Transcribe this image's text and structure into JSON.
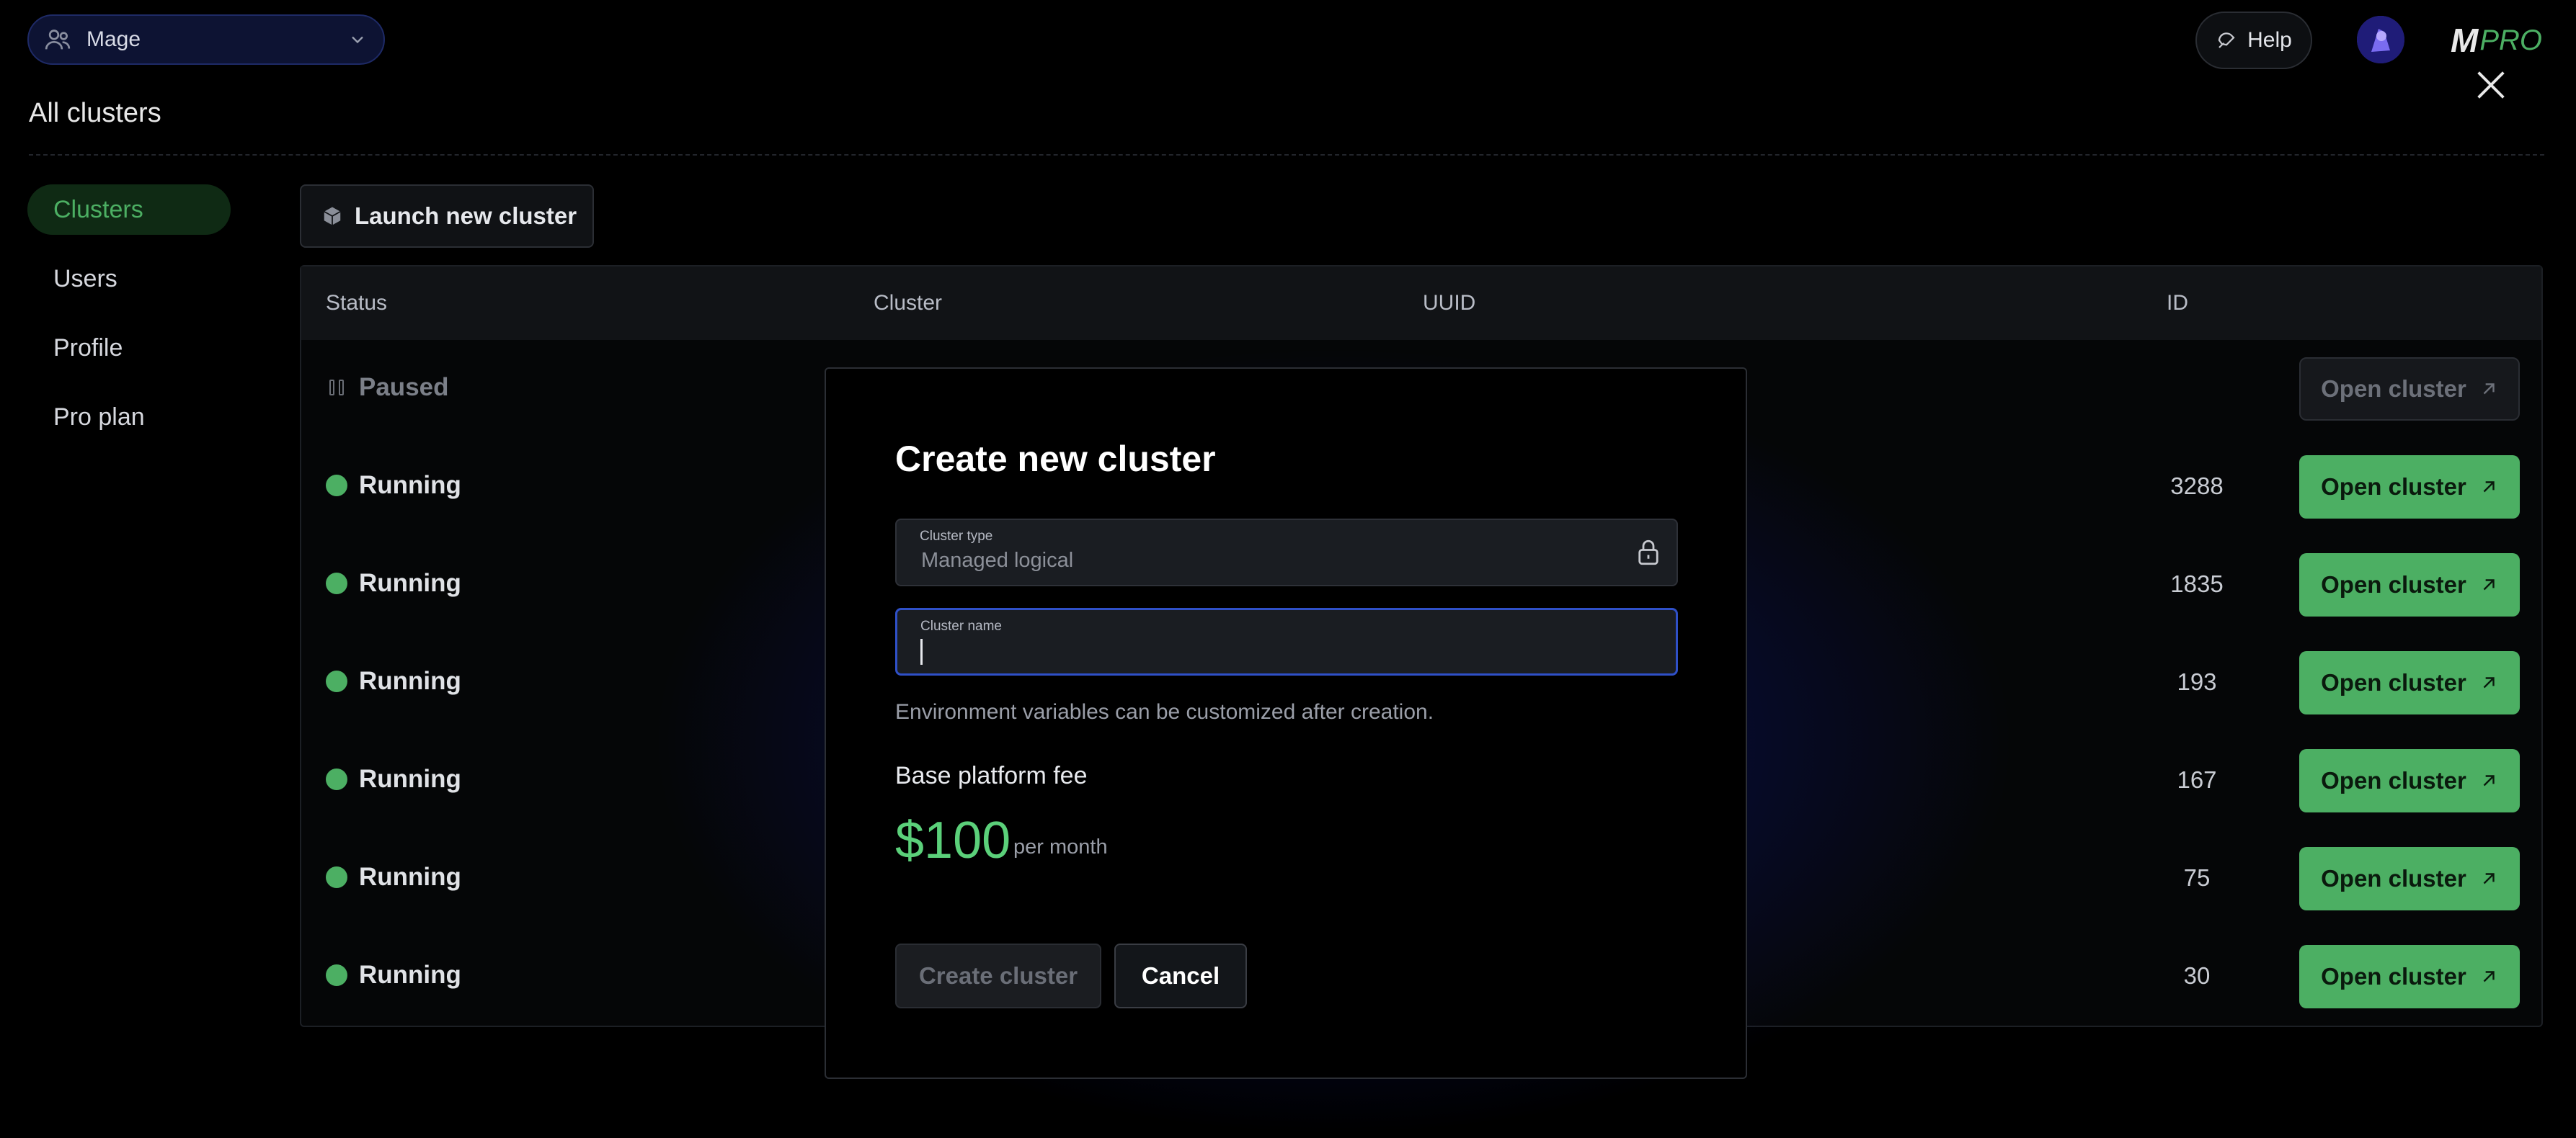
{
  "header": {
    "workspace": "Mage",
    "help_label": "Help",
    "logo_mark": "M",
    "logo_pro": "PRO"
  },
  "page_title": "All clusters",
  "sidebar": {
    "items": [
      {
        "label": "Clusters",
        "active": true
      },
      {
        "label": "Users",
        "active": false
      },
      {
        "label": "Profile",
        "active": false
      },
      {
        "label": "Pro plan",
        "active": false
      }
    ]
  },
  "launch_label": "Launch new cluster",
  "table": {
    "columns": [
      "Status",
      "Cluster",
      "UUID",
      "ID"
    ],
    "rows": [
      {
        "status": "Paused",
        "id": "",
        "action": "Open cluster"
      },
      {
        "status": "Running",
        "id": "3288",
        "action": "Open cluster"
      },
      {
        "status": "Running",
        "id": "1835",
        "action": "Open cluster"
      },
      {
        "status": "Running",
        "id": "193",
        "action": "Open cluster"
      },
      {
        "status": "Running",
        "id": "167",
        "action": "Open cluster"
      },
      {
        "status": "Running",
        "id": "75",
        "action": "Open cluster"
      },
      {
        "status": "Running",
        "id": "30",
        "action": "Open cluster"
      }
    ]
  },
  "modal": {
    "title": "Create new cluster",
    "cluster_type_label": "Cluster type",
    "cluster_type_value": "Managed logical",
    "cluster_name_label": "Cluster name",
    "cluster_name_value": "",
    "help_text": "Environment variables can be customized after creation.",
    "fee_label": "Base platform fee",
    "price": "$100",
    "price_period": "per month",
    "create_label": "Create cluster",
    "cancel_label": "Cancel"
  },
  "colors": {
    "accent_green": "#4caf63",
    "price_green": "#5bd07a",
    "focus_blue": "#2f50c8"
  },
  "icons": [
    "users-icon",
    "chevron-down-icon",
    "help-icon",
    "close-icon",
    "cube-icon",
    "pause-icon",
    "status-dot-icon",
    "arrow-up-right-icon",
    "lock-icon"
  ]
}
